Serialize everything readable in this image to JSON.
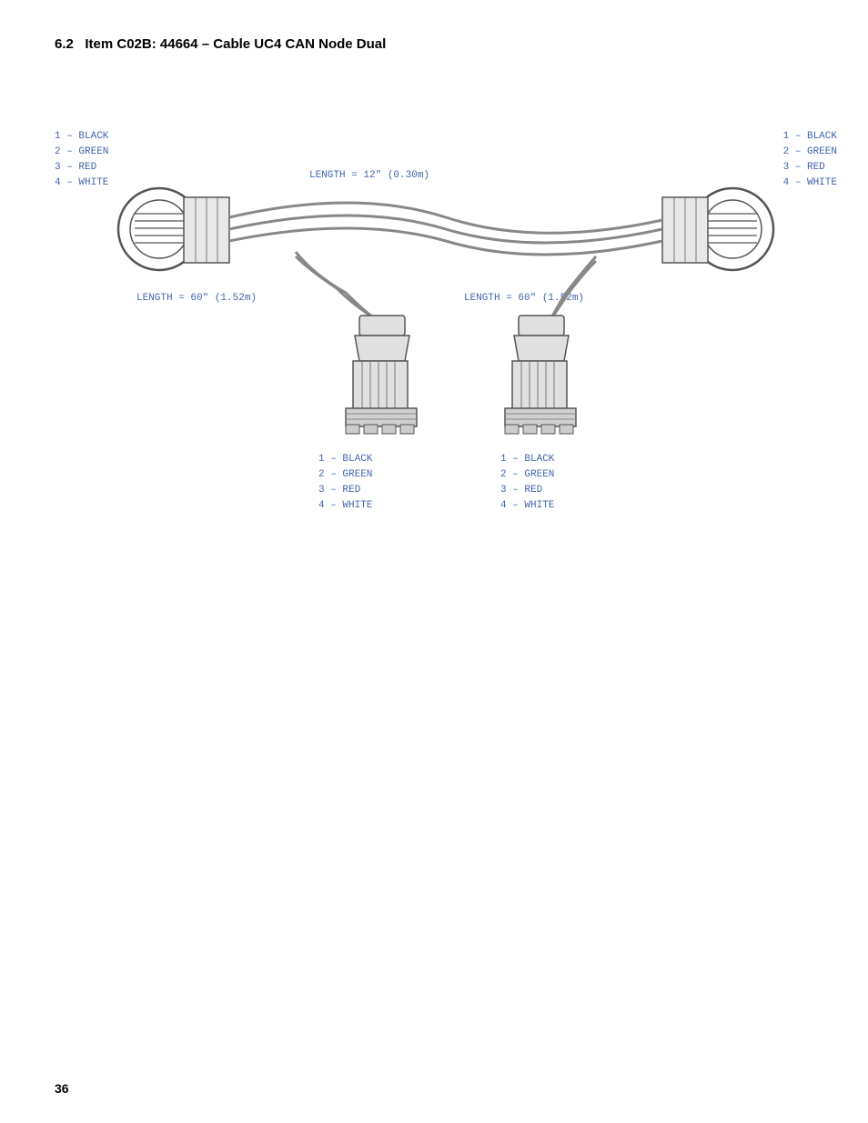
{
  "page": {
    "number": "36",
    "section": "6.2",
    "title_prefix": "Item C02B: 44664 – Cable UC4 CAN Node Dual"
  },
  "diagram": {
    "length_top": "LENGTH = 12\" (0.30m)",
    "length_left": "LENGTH = 60\" (1.52m)",
    "length_right": "LENGTH = 60\" (1.52m)",
    "left_connector_labels": [
      "1 – BLACK",
      "2 – GREEN",
      "3 – RED",
      "4 – WHITE"
    ],
    "right_connector_labels": [
      "1 – BLACK",
      "2 – GREEN",
      "3 – RED",
      "4 – WHITE"
    ],
    "bottom_left_labels": [
      "1 – BLACK",
      "2 – GREEN",
      "3 – RED",
      "4 – WHITE"
    ],
    "bottom_right_labels": [
      "1 – BLACK",
      "2 – GREEN",
      "3 – RED",
      "4 – WHITE"
    ],
    "colors": {
      "label": "#4466cc",
      "connector": "#333333",
      "wire": "#888888"
    }
  }
}
